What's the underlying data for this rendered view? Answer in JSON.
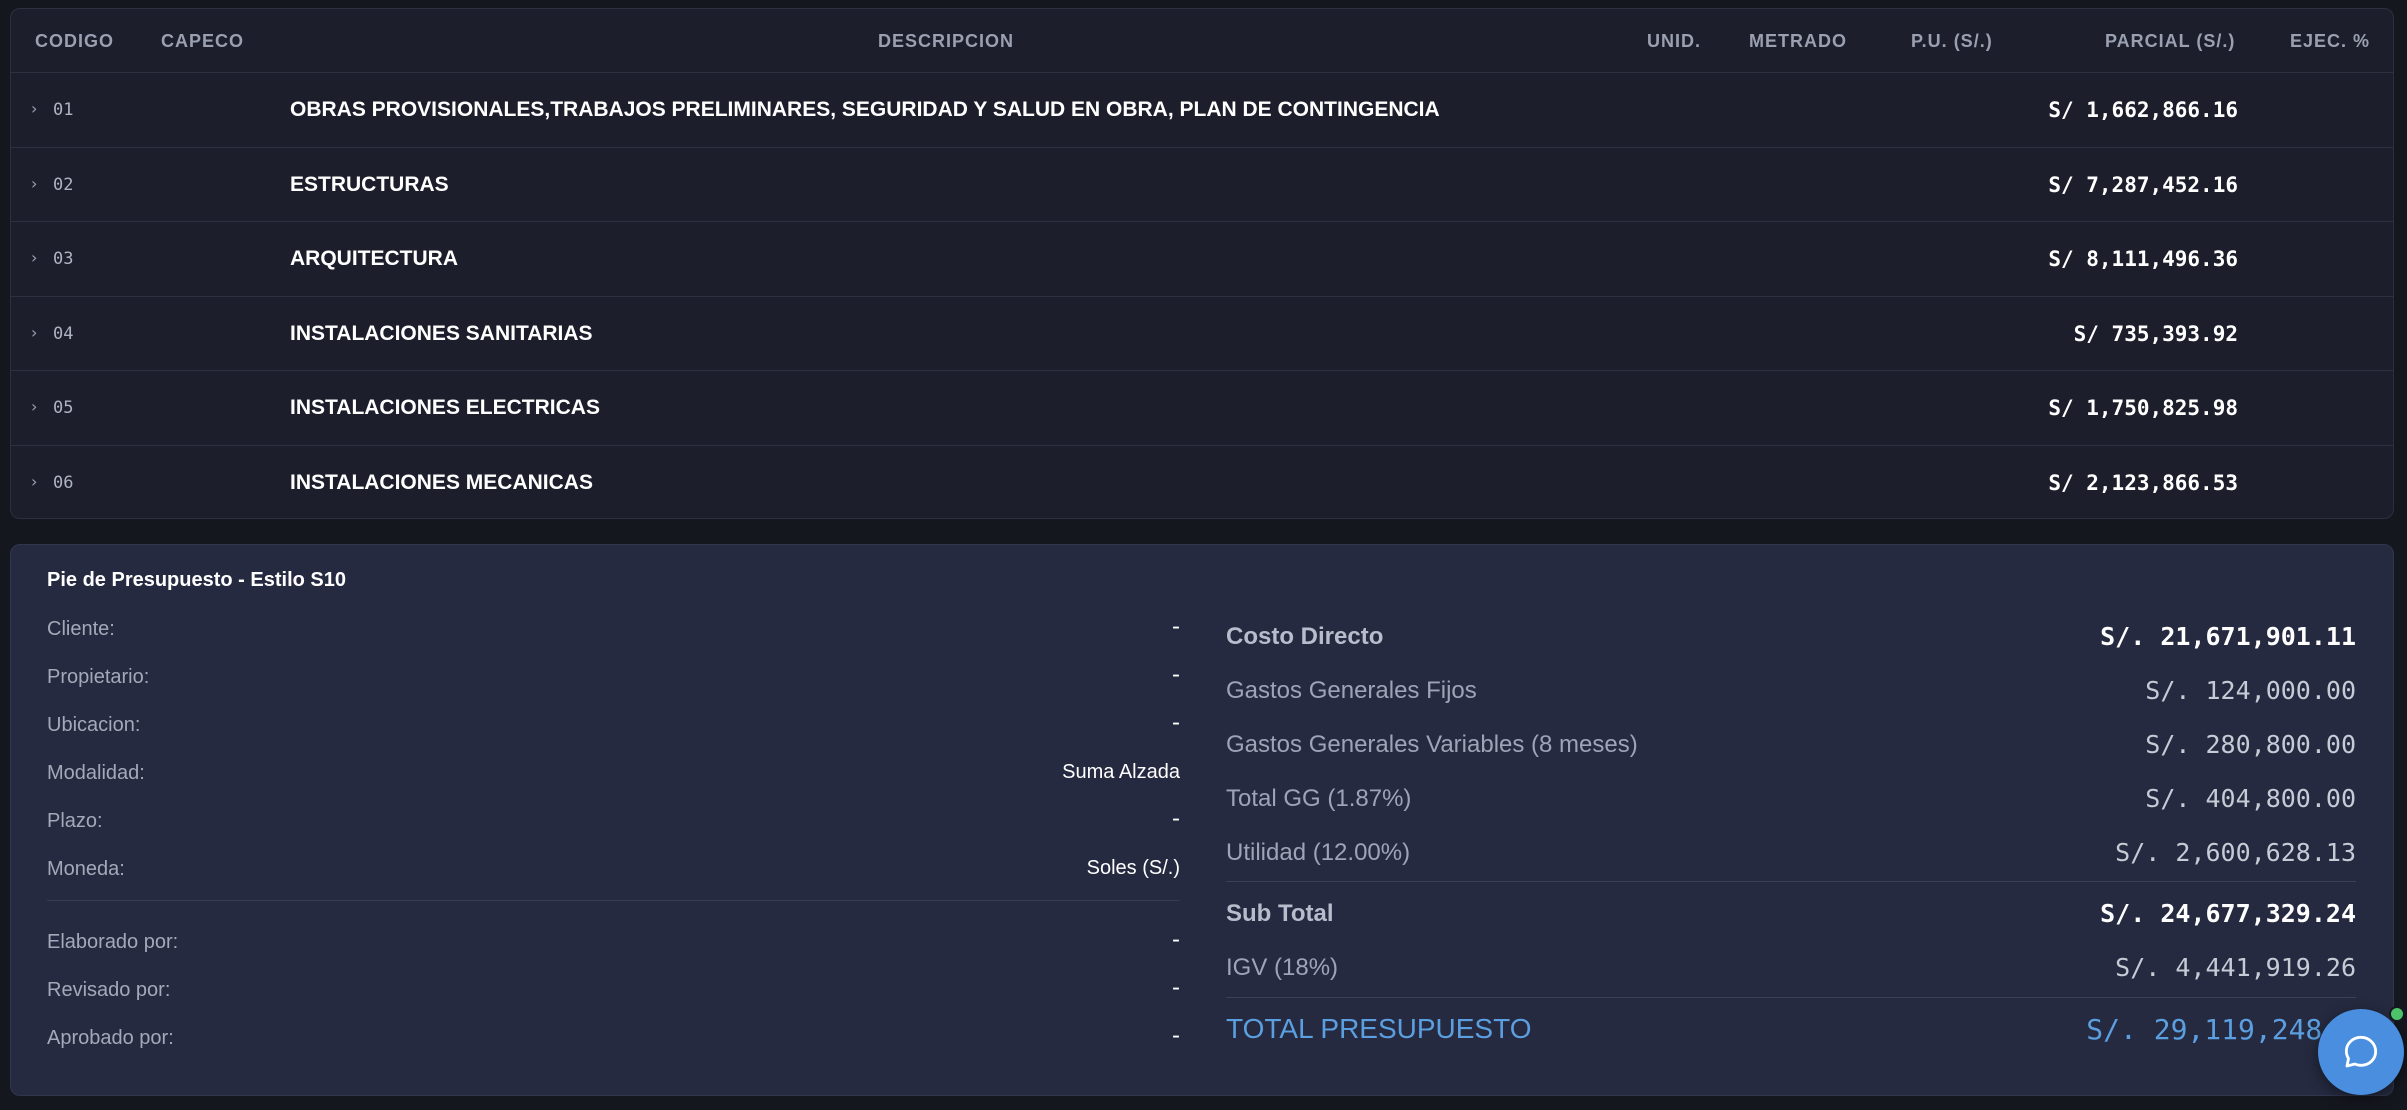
{
  "table": {
    "headers": {
      "codigo": "CODIGO",
      "capeco": "CAPECO",
      "descripcion": "DESCRIPCION",
      "unid": "UNID.",
      "metrado": "METRADO",
      "pu": "P.U. (S/.)",
      "parcial": "PARCIAL (S/.)",
      "ejec": "EJEC. %"
    },
    "rows": [
      {
        "code": "01",
        "description": "OBRAS PROVISIONALES,TRABAJOS PRELIMINARES, SEGURIDAD Y SALUD EN OBRA, PLAN DE CONTINGENCIA",
        "parcial": "S/ 1,662,866.16"
      },
      {
        "code": "02",
        "description": "ESTRUCTURAS",
        "parcial": "S/ 7,287,452.16"
      },
      {
        "code": "03",
        "description": "ARQUITECTURA",
        "parcial": "S/ 8,111,496.36"
      },
      {
        "code": "04",
        "description": "INSTALACIONES SANITARIAS",
        "parcial": "S/ 735,393.92"
      },
      {
        "code": "05",
        "description": "INSTALACIONES ELECTRICAS",
        "parcial": "S/ 1,750,825.98"
      },
      {
        "code": "06",
        "description": "INSTALACIONES MECANICAS",
        "parcial": "S/ 2,123,866.53"
      }
    ]
  },
  "footer": {
    "title": "Pie de Presupuesto - Estilo S10",
    "info": [
      {
        "label": "Cliente:",
        "value": "-"
      },
      {
        "label": "Propietario:",
        "value": "-"
      },
      {
        "label": "Ubicacion:",
        "value": "-"
      },
      {
        "label": "Modalidad:",
        "value": "Suma Alzada"
      },
      {
        "label": "Plazo:",
        "value": "-"
      },
      {
        "label": "Moneda:",
        "value": "Soles (S/.)"
      }
    ],
    "signatures": [
      {
        "label": "Elaborado por:",
        "value": "-"
      },
      {
        "label": "Revisado por:",
        "value": "-"
      },
      {
        "label": "Aprobado por:",
        "value": "-"
      }
    ],
    "summary": {
      "costo_directo": {
        "label": "Costo Directo",
        "value": "S/. 21,671,901.11"
      },
      "gg_fijos": {
        "label": "Gastos Generales Fijos",
        "value": "S/. 124,000.00"
      },
      "gg_variables": {
        "label": "Gastos Generales Variables (8 meses)",
        "value": "S/. 280,800.00"
      },
      "total_gg": {
        "label": "Total GG (1.87%)",
        "value": "S/. 404,800.00"
      },
      "utilidad": {
        "label": "Utilidad (12.00%)",
        "value": "S/. 2,600,628.13"
      },
      "sub_total": {
        "label": "Sub Total",
        "value": "S/. 24,677,329.24"
      },
      "igv": {
        "label": "IGV (18%)",
        "value": "S/. 4,441,919.26"
      },
      "total": {
        "label": "TOTAL PRESUPUESTO",
        "value": "S/. 29,119,248.5"
      }
    }
  },
  "chat": {
    "icon": "chat-bubble-icon",
    "status_color": "#4cc36b",
    "accent": "#4a8fdf"
  }
}
